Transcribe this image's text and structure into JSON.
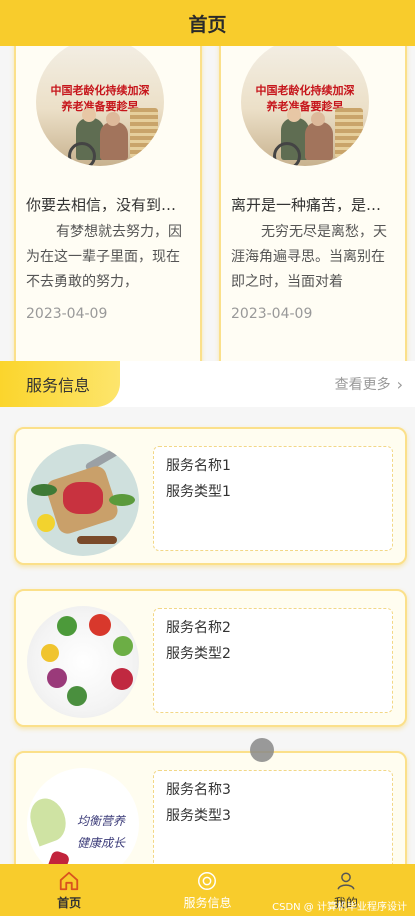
{
  "header": {
    "title": "首页"
  },
  "news": [
    {
      "thumb_text": [
        "中国老龄化持续加深",
        "养老准备要趁早"
      ],
      "title": "你要去相信，没有到…",
      "body": "有梦想就去努力，因为在这一辈子里面，现在不去勇敢的努力，",
      "date": "2023-04-09"
    },
    {
      "thumb_text": [
        "中国老龄化持续加深",
        "养老准备要趁早"
      ],
      "title": "离开是一种痛苦，是…",
      "body": "无穷无尽是离愁，天涯海角遍寻思。当离别在即之时，当面对着",
      "date": "2023-04-09"
    }
  ],
  "section": {
    "title": "服务信息",
    "more": "查看更多"
  },
  "services": [
    {
      "name": "服务名称1",
      "type": "服务类型1"
    },
    {
      "name": "服务名称2",
      "type": "服务类型2"
    },
    {
      "name": "服务名称3",
      "type": "服务类型3",
      "image_text": [
        "均衡营养",
        "健康成长"
      ]
    }
  ],
  "tabbar": [
    {
      "label": "首页",
      "icon": "home-icon"
    },
    {
      "label": "服务信息",
      "icon": "service-icon"
    },
    {
      "label": "我的",
      "icon": "user-icon"
    }
  ],
  "watermark": "CSDN @ 计算机毕业程序设计",
  "colors": {
    "accent": "#f8cc2c",
    "card_border": "#fbe08a",
    "thumb_text": "#c6151b"
  }
}
